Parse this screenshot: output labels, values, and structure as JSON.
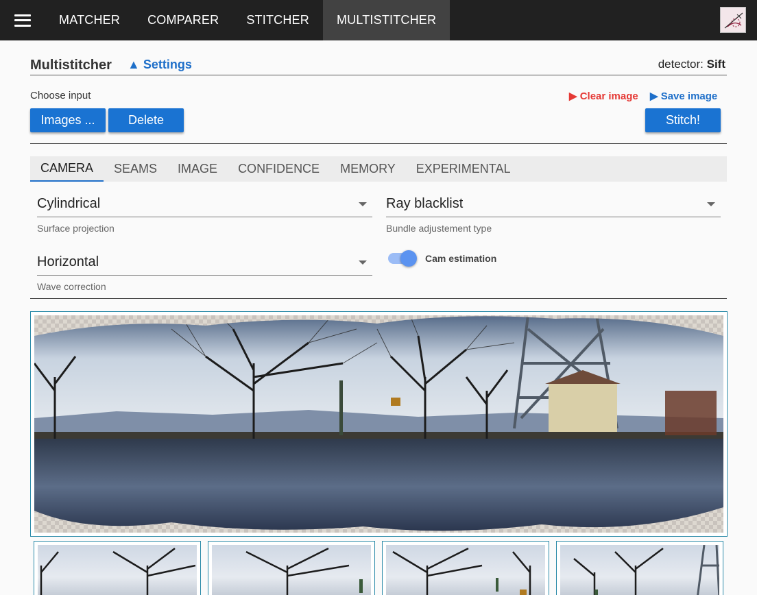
{
  "nav": {
    "tabs": [
      "MATCHER",
      "COMPARER",
      "STITCHER",
      "MULTISTITCHER"
    ],
    "active_tab": "MULTISTITCHER"
  },
  "header": {
    "title": "Multistitcher",
    "settings_label": "▲ Settings",
    "detector_prefix": "detector:",
    "detector_value": "Sift"
  },
  "input": {
    "choose_label": "Choose input",
    "images_button": "Images ...",
    "delete_button": "Delete",
    "clear_image": "▶ Clear image",
    "save_image": "▶ Save image",
    "stitch_button": "Stitch!"
  },
  "settings_tabs": [
    "CAMERA",
    "SEAMS",
    "IMAGE",
    "CONFIDENCE",
    "MEMORY",
    "EXPERIMENTAL"
  ],
  "active_settings_tab": "CAMERA",
  "camera": {
    "surface_projection": {
      "value": "Cylindrical",
      "hint": "Surface projection"
    },
    "bundle_adjustment": {
      "value": "Ray blacklist",
      "hint": "Bundle adjustement type"
    },
    "wave_correction": {
      "value": "Horizontal",
      "hint": "Wave correction"
    },
    "cam_estimation": {
      "label": "Cam estimation",
      "enabled": true
    }
  },
  "colors": {
    "topbar": "#212121",
    "primary_button": "#1a73d2",
    "link_blue": "#1e6fc9",
    "link_red": "#e53935",
    "frame_border": "#2a8aa8"
  }
}
